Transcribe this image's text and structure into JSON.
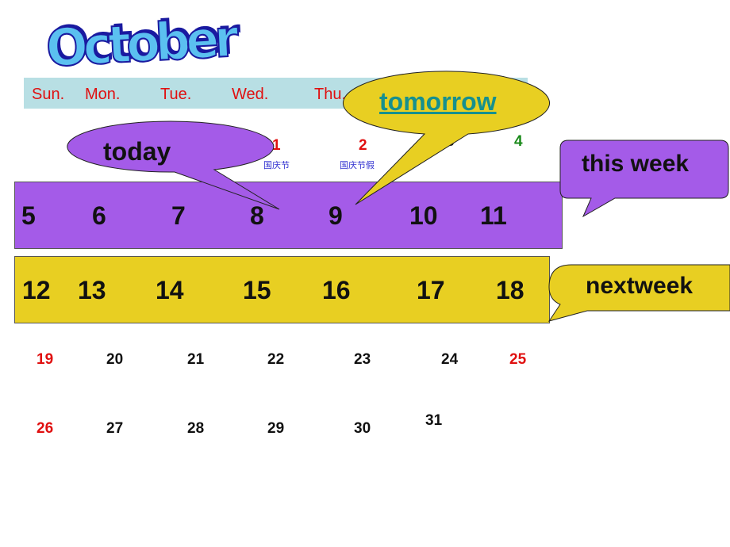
{
  "title": "October",
  "weekdays": [
    "Sun.",
    "Mon.",
    "Tue.",
    "Wed.",
    "Thu."
  ],
  "week0": {
    "days": [
      "1",
      "2",
      "3",
      "4"
    ],
    "notes": [
      "国庆节",
      "国庆节假"
    ]
  },
  "week1": [
    "5",
    "6",
    "7",
    "8",
    "9",
    "10",
    "11"
  ],
  "week2": [
    "12",
    "13",
    "14",
    "15",
    "16",
    "17",
    "18"
  ],
  "week3": [
    "19",
    "20",
    "21",
    "22",
    "23",
    "24",
    "25"
  ],
  "week4": [
    "26",
    "27",
    "28",
    "29",
    "30",
    "31"
  ],
  "callouts": {
    "today": "today",
    "tomorrow": "tomorrow",
    "this_week": "this week",
    "next_week": "nextweek"
  },
  "colors": {
    "purple": "#a45be8",
    "yellow": "#e8cf22",
    "header": "#b8dfe4",
    "weekend": "#e01010",
    "tomorrow_text": "#16908e"
  }
}
